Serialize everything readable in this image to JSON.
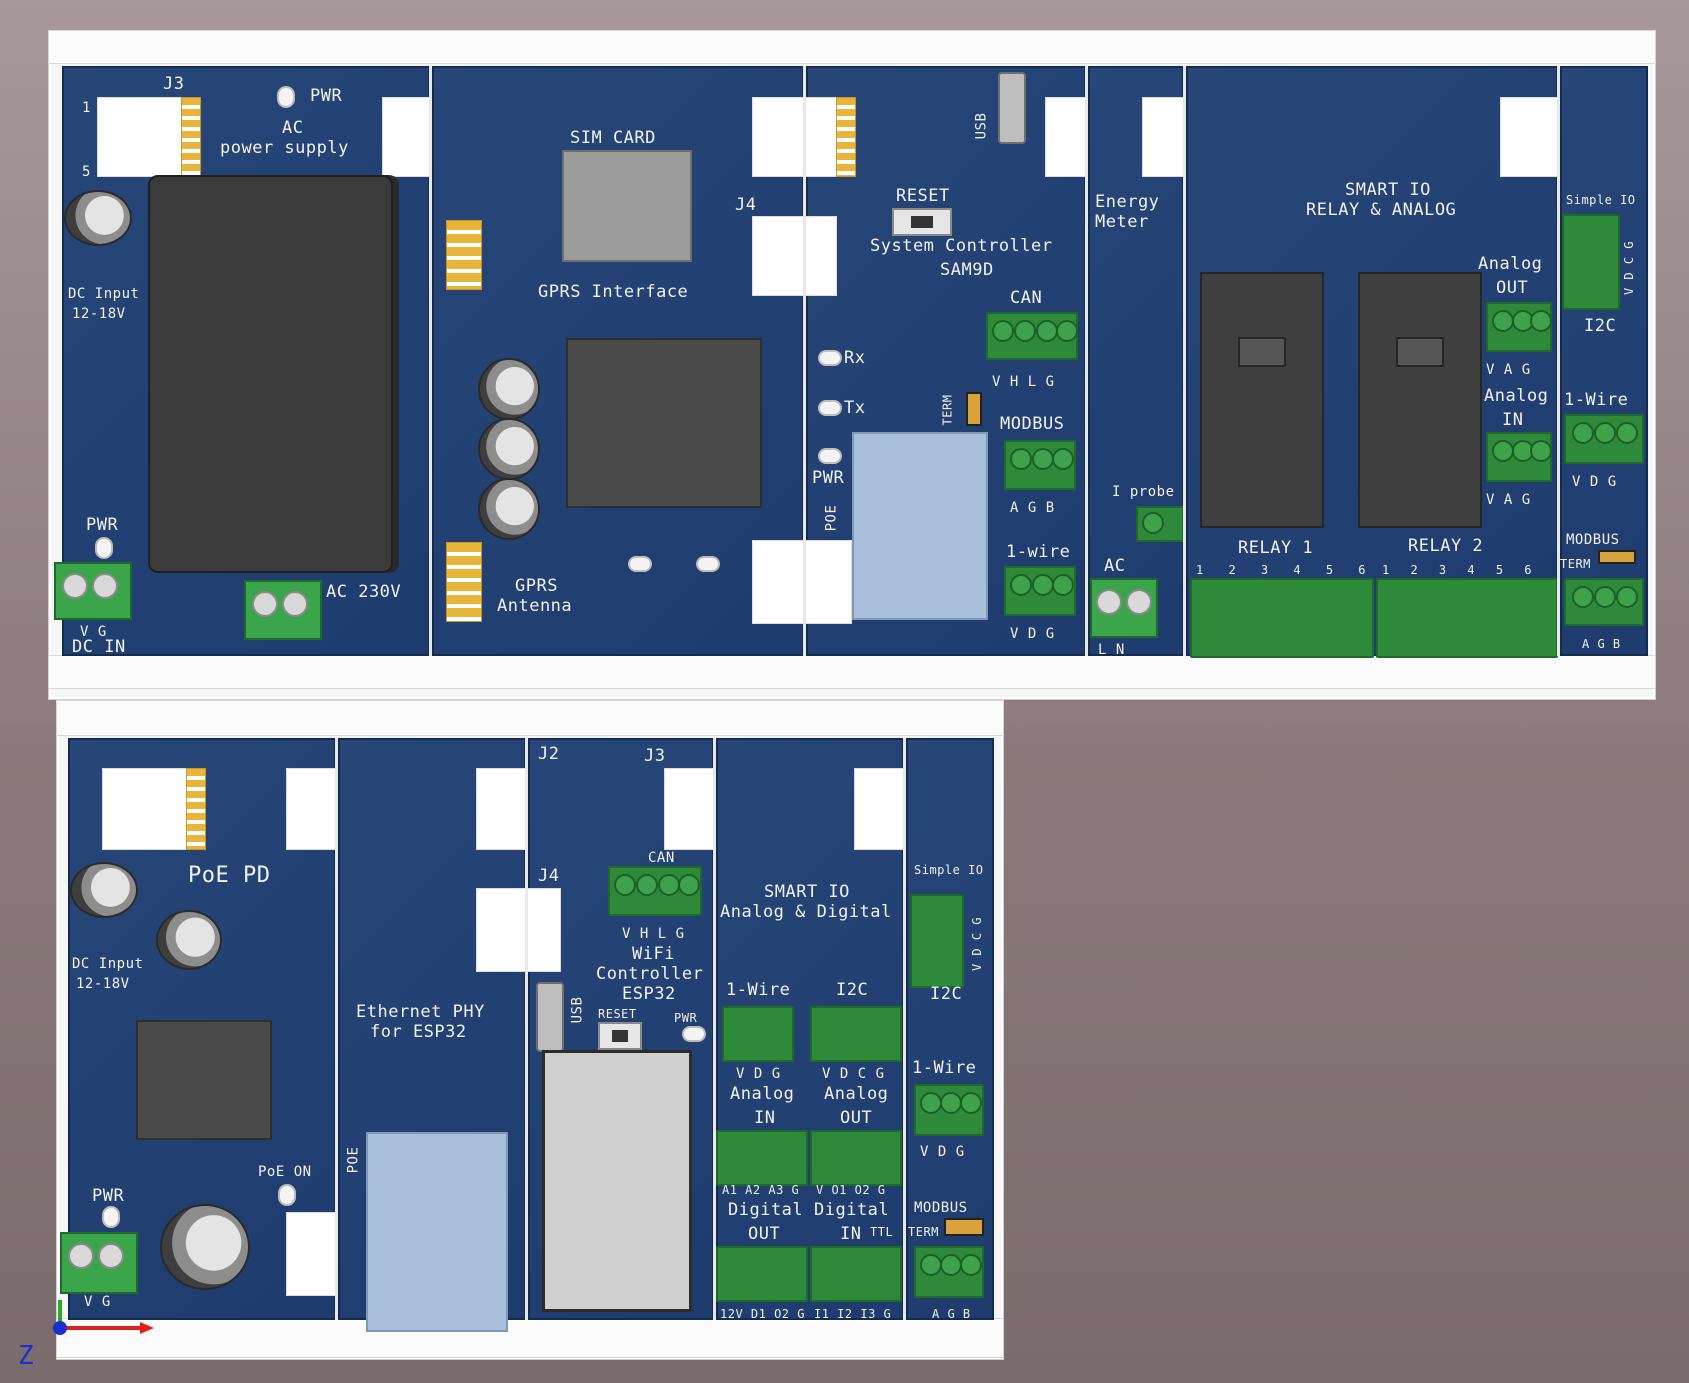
{
  "top_assembly": {
    "power_module": {
      "connector_j3": "J3",
      "pin_1": "1",
      "pin_5": "5",
      "pwr_led_label": "PWR",
      "title_line1": "AC",
      "title_line2": "power supply",
      "dc_input_line1": "DC Input",
      "dc_input_line2": "12-18V",
      "pwr_label": "PWR",
      "dc_in_pins": "V  G",
      "dc_in_label": "DC IN",
      "ac_label": "AC 230V"
    },
    "gprs_module": {
      "sim_card": "SIM CARD",
      "title": "GPRS Interface",
      "antenna_line1": "GPRS",
      "antenna_line2": "Antenna"
    },
    "controller_module": {
      "j4": "J4",
      "usb": "USB",
      "reset": "RESET",
      "title_line1": "System Controller",
      "title_line2": "SAM9D",
      "can": "CAN",
      "can_pins": "V H L G",
      "term": "TERM",
      "modbus": "MODBUS",
      "modbus_pins": "A G B",
      "onewire": "1-wire",
      "onewire_pins": "V D G",
      "rx": "Rx",
      "tx": "Tx",
      "pwr": "PWR",
      "poe": "POE"
    },
    "energy_module": {
      "title_line1": "Energy",
      "title_line2": "Meter",
      "iprobe": "I probe",
      "ac": "AC",
      "ac_pins": "L   N"
    },
    "relay_module": {
      "title_line1": "SMART IO",
      "title_line2": "RELAY & ANALOG",
      "analog_out_line1": "Analog",
      "analog_out_line2": "OUT",
      "analog_out_pins": "V A G",
      "analog_in_line1": "Analog",
      "analog_in_line2": "IN",
      "analog_in_pins": "V A G",
      "relay1": "RELAY 1",
      "relay2": "RELAY 2",
      "relay_pins": [
        "1",
        "2",
        "3",
        "4",
        "5",
        "6"
      ]
    },
    "simple_io_module": {
      "title": "Simple IO",
      "i2c_pins": "V D C G",
      "i2c": "I2C",
      "onewire": "1-Wire",
      "onewire_pins": "V D G",
      "modbus": "MODBUS",
      "term": "TERM",
      "modbus_pins": "A G B"
    }
  },
  "bottom_assembly": {
    "poe_module": {
      "title": "PoE PD",
      "dc_input_line1": "DC Input",
      "dc_input_line2": "12-18V",
      "pwr": "PWR",
      "poe_on": "PoE ON",
      "dc_in_pins": "V  G"
    },
    "ethernet_module": {
      "title_line1": "Ethernet PHY",
      "title_line2": "for ESP32",
      "poe": "POE"
    },
    "wifi_module": {
      "j2": "J2",
      "j3": "J3",
      "j4": "J4",
      "can": "CAN",
      "can_pins": "V H L G",
      "title_line1": "WiFi",
      "title_line2": "Controller",
      "title_line3": "ESP32",
      "usb": "USB",
      "reset": "RESET",
      "pwr": "PWR"
    },
    "smart_io_module": {
      "title_line1": "SMART IO",
      "title_line2": "Analog & Digital",
      "onewire": "1-Wire",
      "onewire_pins": "V D G",
      "i2c": "I2C",
      "i2c_pins": "V D C G",
      "analog_in_line1": "Analog",
      "analog_in_line2": "IN",
      "analog_in_pins": "A1 A2 A3 G",
      "analog_out_line1": "Analog",
      "analog_out_line2": "OUT",
      "analog_out_pins": "V O1 O2 G",
      "digital_out_line1": "Digital",
      "digital_out_line2": "OUT",
      "digital_out_pins": "12V D1 O2 G",
      "digital_in_line1": "Digital",
      "digital_in_line2": "IN",
      "ttl": "TTL",
      "digital_in_pins": "I1 I2 I3 G"
    },
    "simple_io_module": {
      "title": "Simple IO",
      "i2c_pins": "V D C G",
      "i2c": "I2C",
      "onewire": "1-Wire",
      "onewire_pins": "V D G",
      "modbus": "MODBUS",
      "term": "TERM",
      "modbus_pins": "A G B"
    }
  },
  "axis_label": "Z"
}
